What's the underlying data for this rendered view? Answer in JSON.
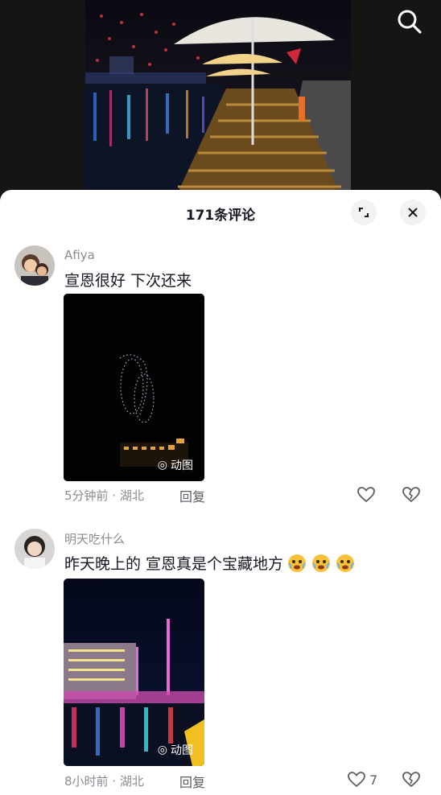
{
  "search": {
    "icon": "search-icon"
  },
  "sheet": {
    "title": "171条评论",
    "expand_icon": "expand-icon",
    "close_icon": "close-icon"
  },
  "comments": [
    {
      "username": "Afiya",
      "text": "宣恩很好 下次还来",
      "image_badge": "动图",
      "meta": "5分钟前 · 湖北",
      "reply": "回复",
      "likes": ""
    },
    {
      "username": "明天吃什么",
      "text": "昨天晚上的 宣恩真是个宝藏地方",
      "emojis": [
        "laughing-tears-emoji",
        "laughing-tears-emoji",
        "laughing-tears-emoji"
      ],
      "image_badge": "动图",
      "meta": "8小时前 · 湖北",
      "reply": "回复",
      "likes": "7"
    }
  ],
  "colors": {
    "accent_text": "#161823",
    "secondary_text": "#8a8b91",
    "sheet_bg": "#ffffff"
  }
}
